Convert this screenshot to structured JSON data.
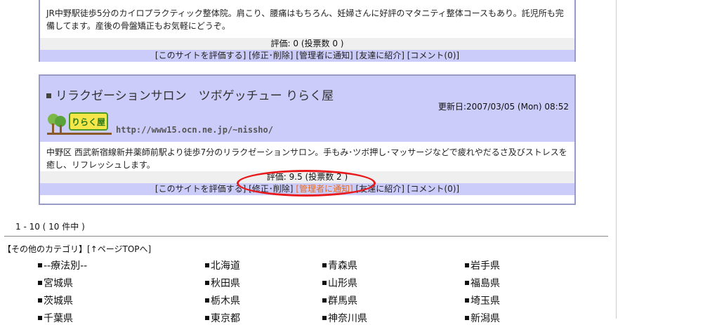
{
  "listing1": {
    "description": "JR中野駅徒歩5分のカイロプラクティック整体院。肩こり、腰痛はもちろん、妊婦さんに好評のマタニティ整体コースもあり。託児所も完備してます。産後の骨盤矯正もお気軽にどうぞ。",
    "rating": "評価: 0 (投票数 0 )",
    "links": {
      "rate": "[このサイトを評価する]",
      "edit": "[修正･削除]",
      "notify": "[管理者に通知]",
      "friend": "[友達に紹介]",
      "comment": "[コメント(0)]"
    }
  },
  "listing2": {
    "title": "リラクゼーションサロン　ツボゲッチュー りらく屋",
    "updated": "更新日:2007/03/05 (Mon) 08:52",
    "logo_text": "りらく屋",
    "url": "http://www15.ocn.ne.jp/~nissho/",
    "description": "中野区 西武新宿線新井薬師前駅より徒歩7分のリラクゼーションサロン。手もみ･ツボ押し･マッサージなどで疲れやだるさ及びストレスを癒し、リフレッシュします。",
    "rating": "評価: 9.5 (投票数 2 )",
    "links": {
      "rate": "[このサイトを評価する]",
      "edit": "[修正･削除]",
      "notify": "[管理者に通知]",
      "friend": "[友達に紹介]",
      "comment": "[コメント(0)]"
    }
  },
  "pager": "1 - 10 ( 10 件中 )",
  "other_category": "【その他のカテゴリ】",
  "page_top": "[↑ページTOPへ]",
  "categories": [
    [
      "--療法別--",
      "北海道",
      "青森県",
      "岩手県"
    ],
    [
      "宮城県",
      "秋田県",
      "山形県",
      "福島県"
    ],
    [
      "茨城県",
      "栃木県",
      "群馬県",
      "埼玉県"
    ],
    [
      "千葉県",
      "東京都",
      "神奈川県",
      "新潟県"
    ]
  ],
  "colors": {
    "link_bar": "#ccccfa",
    "card_border": "#9a9ac9",
    "highlight": "#e86a1a",
    "annotation_circle": "#e8191b"
  }
}
